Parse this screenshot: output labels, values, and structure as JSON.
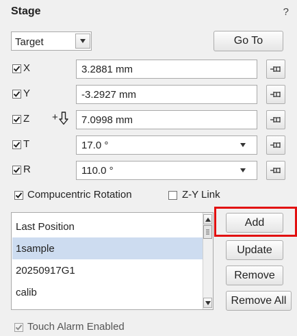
{
  "panel": {
    "title": "Stage",
    "help": "?"
  },
  "target": {
    "value": "Target",
    "go_to_label": "Go To"
  },
  "axes": [
    {
      "label": "X",
      "value": "3.2881 mm",
      "checked": true,
      "pin_icon": "pin-icon"
    },
    {
      "label": "Y",
      "value": "-3.2927 mm",
      "checked": true,
      "pin_icon": "pin-icon"
    },
    {
      "label": "Z",
      "value": "7.0998 mm",
      "checked": true,
      "prefix": "+",
      "pin_icon": "pin-icon"
    },
    {
      "label": "T",
      "value": "17.0 °",
      "checked": true,
      "pin_icon": "pin-icon"
    },
    {
      "label": "R",
      "value": "110.0 °",
      "checked": true,
      "pin_icon": "pin-icon"
    }
  ],
  "options": {
    "compucentric_label": "Compucentric Rotation",
    "compucentric_checked": true,
    "zy_link_label": "Z-Y Link",
    "zy_link_checked": false
  },
  "positions": {
    "items": [
      "Last Position",
      "1sample",
      "20250917G1",
      "calib"
    ],
    "selected": "1sample"
  },
  "buttons": {
    "add": "Add",
    "update": "Update",
    "remove": "Remove",
    "remove_all": "Remove All"
  },
  "touch_alarm": {
    "label": "Touch Alarm Enabled",
    "checked": true,
    "enabled": false
  },
  "colors": {
    "highlight": "#e21010",
    "selection": "#cddcf0"
  }
}
